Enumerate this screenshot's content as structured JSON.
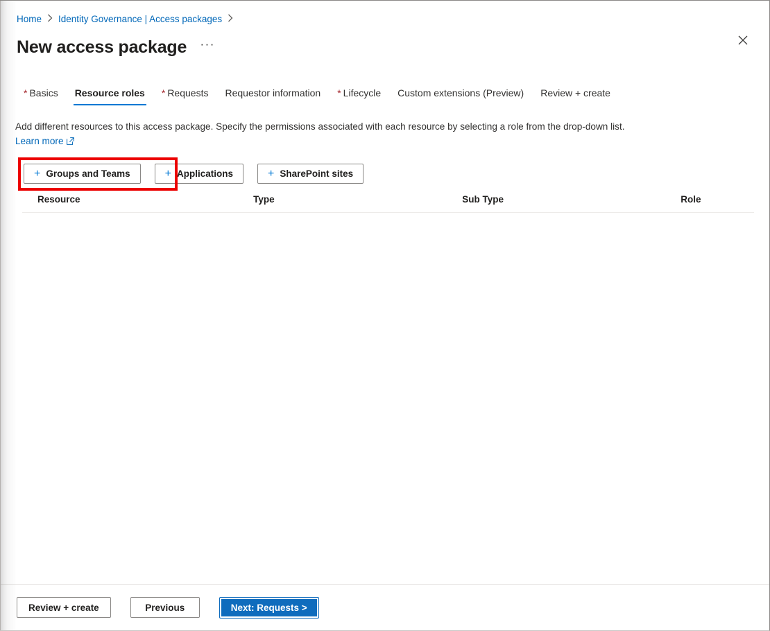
{
  "window": {
    "close_icon": "close-icon",
    "ellipsis_label": "···"
  },
  "breadcrumb": {
    "items": [
      {
        "label": "Home",
        "is_link": true
      },
      {
        "label": "Identity Governance | Access packages",
        "is_link": true
      }
    ],
    "separator_icon": "chevron-right-icon"
  },
  "header": {
    "title": "New access package"
  },
  "tabs": [
    {
      "label": "Basics",
      "required": true,
      "active": false
    },
    {
      "label": "Resource roles",
      "required": false,
      "active": true
    },
    {
      "label": "Requests",
      "required": true,
      "active": false
    },
    {
      "label": "Requestor information",
      "required": false,
      "active": false
    },
    {
      "label": "Lifecycle",
      "required": true,
      "active": false
    },
    {
      "label": "Custom extensions (Preview)",
      "required": false,
      "active": false
    },
    {
      "label": "Review + create",
      "required": false,
      "active": false
    }
  ],
  "main": {
    "description_part1": "Add different resources to this access package. Specify the permissions associated with each resource by selecting a role from the drop-down list.",
    "learn_more_label": "Learn more",
    "learn_more_icon": "external-link-icon",
    "command_buttons": [
      {
        "label": "Groups and Teams",
        "icon": "plus-icon",
        "highlighted": true
      },
      {
        "label": "Applications",
        "icon": "plus-icon",
        "highlighted": false
      },
      {
        "label": "SharePoint sites",
        "icon": "plus-icon",
        "highlighted": false
      }
    ],
    "table": {
      "columns": [
        "Resource",
        "Type",
        "Sub Type",
        "Role"
      ],
      "rows": []
    }
  },
  "footer": {
    "buttons": [
      {
        "label": "Review + create",
        "style": "secondary"
      },
      {
        "label": "Previous",
        "style": "secondary"
      },
      {
        "label": "Next: Requests >",
        "style": "primary"
      }
    ]
  },
  "colors": {
    "accent_blue": "#0078d4",
    "link_blue": "#0067b8",
    "primary_button": "#0f6cbd",
    "required_asterisk": "#a4262c",
    "highlight_red": "#ec0000"
  }
}
